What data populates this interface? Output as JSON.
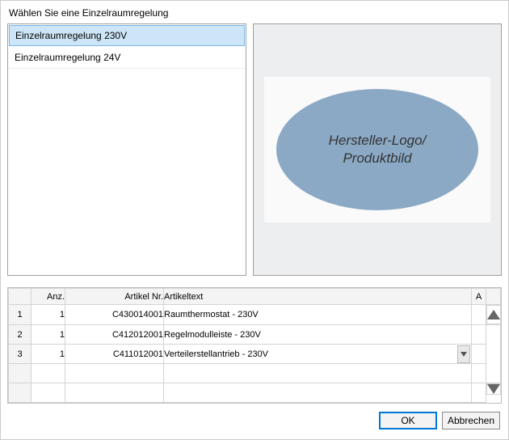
{
  "title": "Wählen Sie eine Einzelraumregelung",
  "list": {
    "items": [
      {
        "label": "Einzelraumregelung 230V",
        "selected": true
      },
      {
        "label": "Einzelraumregelung 24V",
        "selected": false
      }
    ]
  },
  "preview": {
    "placeholder": "Hersteller-Logo/\nProduktbild"
  },
  "grid": {
    "headers": {
      "row": "",
      "anz": "Anz.",
      "artnr": "Artikel Nr.",
      "arttxt": "Artikeltext",
      "a": "A"
    },
    "rows": [
      {
        "n": "1",
        "anz": "1",
        "artnr": "C430014001",
        "arttxt": "Raumthermostat - 230V",
        "a": ""
      },
      {
        "n": "2",
        "anz": "1",
        "artnr": "C412012001",
        "arttxt": "Regelmodulleiste - 230V",
        "a": ""
      },
      {
        "n": "3",
        "anz": "1",
        "artnr": "C411012001",
        "arttxt": "Verteilerstellantrieb  - 230V",
        "a": ""
      }
    ]
  },
  "buttons": {
    "ok": "OK",
    "cancel": "Abbrechen"
  }
}
